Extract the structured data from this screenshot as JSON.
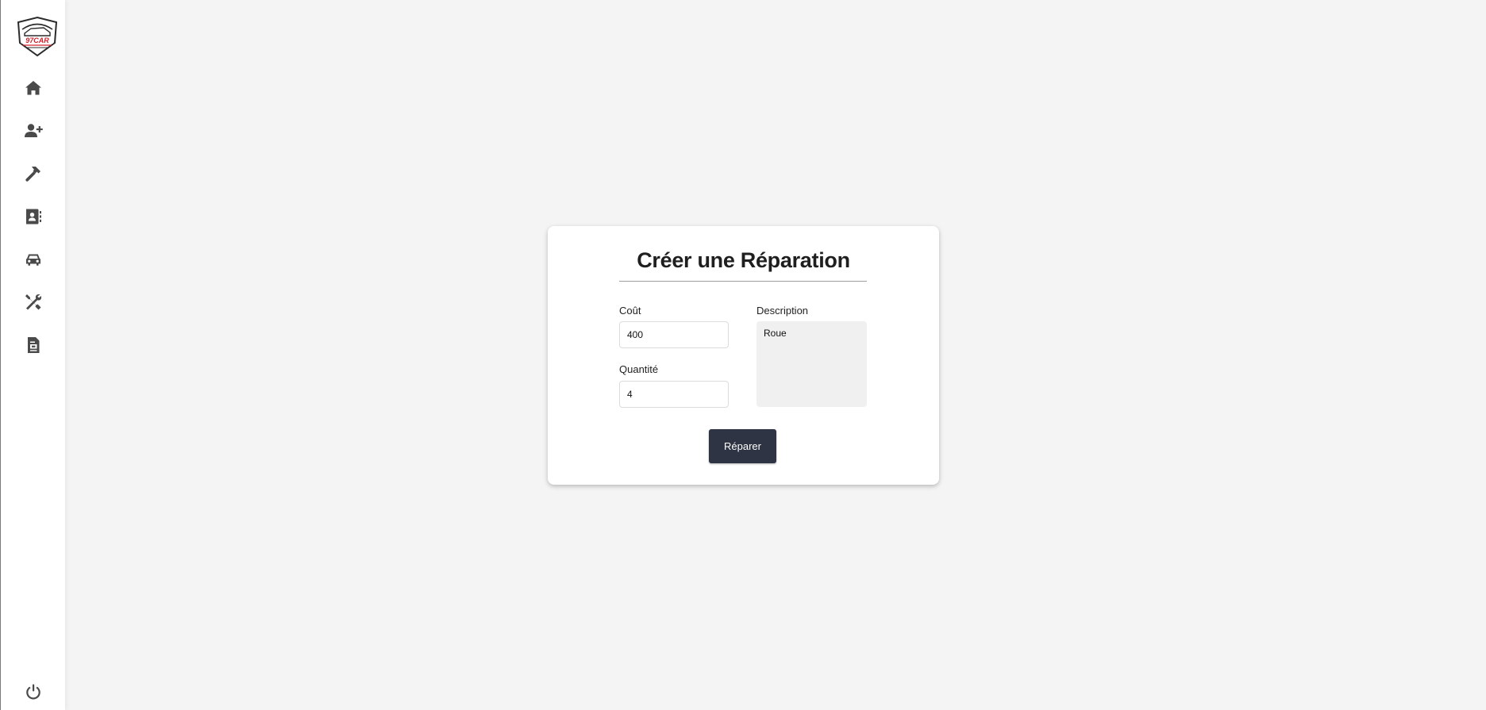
{
  "sidebar": {
    "logo_text": "97CAR",
    "items": [
      {
        "icon": "home-icon",
        "name": "nav-home"
      },
      {
        "icon": "user-plus-icon",
        "name": "nav-add-user"
      },
      {
        "icon": "hammer-icon",
        "name": "nav-repairs"
      },
      {
        "icon": "contact-book-icon",
        "name": "nav-contacts"
      },
      {
        "icon": "car-icon",
        "name": "nav-cars"
      },
      {
        "icon": "tools-icon",
        "name": "nav-tools"
      },
      {
        "icon": "document-icon",
        "name": "nav-documents"
      }
    ],
    "logout_icon": "power-icon"
  },
  "form": {
    "title": "Créer une Réparation",
    "cost_label": "Coût",
    "cost_value": "400",
    "quantity_label": "Quantité",
    "quantity_value": "4",
    "description_label": "Description",
    "description_value": "Roue",
    "submit_label": "Réparer"
  },
  "colors": {
    "background": "#f4f4f4",
    "button": "#2e3444",
    "icon": "#4a4a4a",
    "logo_accent": "#d0202a"
  }
}
